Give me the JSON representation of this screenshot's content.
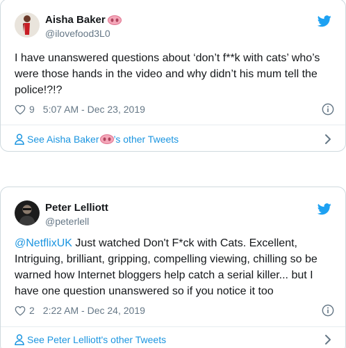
{
  "colors": {
    "accent": "#1b95e0",
    "muted": "#657786",
    "text": "#14171a",
    "border": "#cfd9de"
  },
  "tweets": [
    {
      "name": "Aisha Baker",
      "name_emoji": "pig-nose-emoji",
      "handle": "@ilovefood3L0",
      "text": "I have unanswered questions about ‘don’t f**k with cats’ who’s were those hands in the video and why didn’t his mum tell the police!?!?",
      "mention": "",
      "likes": "9",
      "timestamp": "5:07 AM - Dec 23, 2019",
      "footer_prefix": "See Aisha Baker",
      "footer_suffix": "’s other Tweets"
    },
    {
      "name": "Peter Lelliott",
      "handle": "@peterlell",
      "mention": "@NetflixUK",
      "text": " Just watched Don't F*ck with Cats.  Excellent, Intriguing, brilliant, gripping, compelling viewing, chilling so be warned how Internet bloggers help catch a serial killer... but I have one question unanswered so if you notice it too",
      "likes": "2",
      "timestamp": "2:22 AM - Dec 24, 2019",
      "footer_prefix": "See Peter Lelliott's other Tweets",
      "footer_suffix": ""
    }
  ],
  "icons": {
    "like": "heart-outline-icon",
    "info": "info-circle-icon",
    "brand": "twitter-bird-icon",
    "profile": "person-outline-icon",
    "more": "chevron-right-icon"
  }
}
